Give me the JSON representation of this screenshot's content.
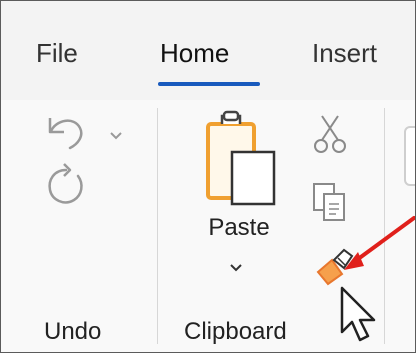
{
  "tabs": [
    {
      "label": "File",
      "active": false
    },
    {
      "label": "Home",
      "active": true
    },
    {
      "label": "Insert",
      "active": false
    }
  ],
  "groups": {
    "undo": {
      "label": "Undo"
    },
    "clipboard": {
      "label": "Clipboard",
      "paste_label": "Paste"
    }
  },
  "colors": {
    "accent": "#185abd",
    "annotation_arrow": "#e0201b",
    "paste_icon": "#f0a030",
    "brush": "#e8772e"
  },
  "icons": [
    "undo-icon",
    "chevron-down-icon",
    "redo-icon",
    "paste-icon",
    "cut-icon",
    "copy-icon",
    "format-painter-icon",
    "mouse-cursor-icon"
  ]
}
